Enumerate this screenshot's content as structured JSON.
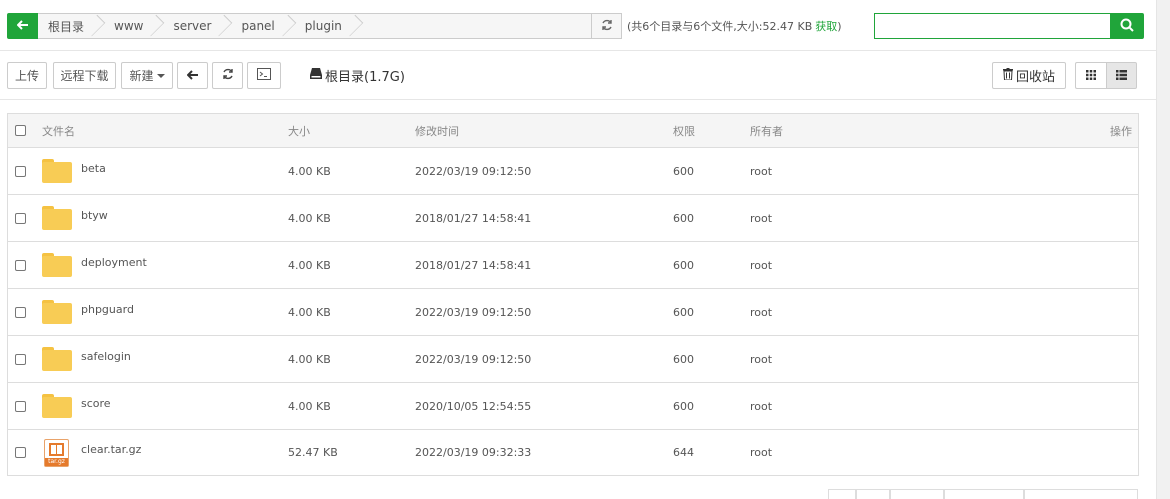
{
  "breadcrumb": {
    "items": [
      "根目录",
      "www",
      "server",
      "panel",
      "plugin"
    ]
  },
  "summary": {
    "text": "(共6个目录与6个文件,大小:52.47 KB",
    "get_link": "获取",
    "close": ")"
  },
  "search": {
    "placeholder": "",
    "value": ""
  },
  "toolbar": {
    "upload": "上传",
    "remote_download": "远程下载",
    "new": "新建",
    "disk_label": "根目录(1.7G)",
    "recycle_bin": "回收站"
  },
  "table": {
    "columns": {
      "name": "文件名",
      "size": "大小",
      "mtime": "修改时间",
      "perm": "权限",
      "owner": "所有者",
      "op": "操作"
    },
    "rows": [
      {
        "name": "beta",
        "type": "folder",
        "size": "4.00 KB",
        "mtime": "2022/03/19 09:12:50",
        "perm": "600",
        "owner": "root"
      },
      {
        "name": "btyw",
        "type": "folder",
        "size": "4.00 KB",
        "mtime": "2018/01/27 14:58:41",
        "perm": "600",
        "owner": "root"
      },
      {
        "name": "deployment",
        "type": "folder",
        "size": "4.00 KB",
        "mtime": "2018/01/27 14:58:41",
        "perm": "600",
        "owner": "root"
      },
      {
        "name": "phpguard",
        "type": "folder",
        "size": "4.00 KB",
        "mtime": "2022/03/19 09:12:50",
        "perm": "600",
        "owner": "root"
      },
      {
        "name": "safelogin",
        "type": "folder",
        "size": "4.00 KB",
        "mtime": "2022/03/19 09:12:50",
        "perm": "600",
        "owner": "root"
      },
      {
        "name": "score",
        "type": "folder",
        "size": "4.00 KB",
        "mtime": "2020/10/05 12:54:55",
        "perm": "600",
        "owner": "root"
      },
      {
        "name": "clear.tar.gz",
        "type": "archive",
        "size": "52.47 KB",
        "mtime": "2022/03/19 09:32:33",
        "perm": "644",
        "owner": "root"
      }
    ]
  },
  "icons": {
    "back": "arrow-left-icon",
    "refresh": "refresh-icon",
    "search": "search-icon",
    "terminal": "terminal-icon",
    "disk": "hdd-icon",
    "trash": "trash-icon",
    "grid": "grid-view-icon",
    "list": "list-view-icon",
    "folder": "folder-icon",
    "archive": "archive-icon",
    "archive_label": "tar.gz"
  },
  "colors": {
    "accent": "#20a53a",
    "folder": "#f8cc55",
    "archive": "#e57a2c"
  }
}
